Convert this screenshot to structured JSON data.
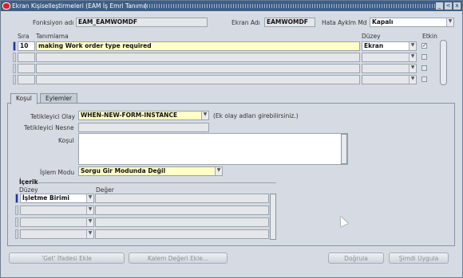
{
  "window": {
    "title": "Ekran Kişiselleştirmeleri (EAM İş Emri Tanımı)",
    "minimize_label": "_",
    "restore_label": "<",
    "close_label": "x"
  },
  "header": {
    "function_label": "Fonksiyon adı",
    "function_value": "EAM_EAMWOMDF",
    "screen_label": "Ekran Adı",
    "screen_value": "EAMWOMDF",
    "error_label": "Hata Ayklm Md",
    "error_value": "Kapalı"
  },
  "grid": {
    "columns": {
      "seq": "Sıra",
      "definition": "Tanımlama",
      "level": "Düzey",
      "active": "Etkin"
    },
    "rows": [
      {
        "seq": "10",
        "definition": "making Work order type required",
        "level": "Ekran",
        "active": "✓"
      },
      {
        "seq": "",
        "definition": "",
        "level": "",
        "active": ""
      },
      {
        "seq": "",
        "definition": "",
        "level": "",
        "active": ""
      },
      {
        "seq": "",
        "definition": "",
        "level": "",
        "active": ""
      }
    ]
  },
  "tabs": [
    {
      "label": "Koşul",
      "active": true
    },
    {
      "label": "Eylemler",
      "active": false
    }
  ],
  "condition": {
    "trigger_event_label": "Tetikleyici Olay",
    "trigger_event_value": "WHEN-NEW-FORM-INSTANCE",
    "trigger_hint": "(Ek olay adları girebilirsiniz.)",
    "trigger_object_label": "Tetikleyici Nesne",
    "trigger_object_value": "",
    "condition_label": "Koşul",
    "condition_value": "",
    "mode_label": "İşlem Modu",
    "mode_value": "Sorgu Gir  Modunda Değil"
  },
  "content": {
    "title": "İçerik",
    "level_header": "Düzey",
    "value_header": "Değer",
    "rows": [
      {
        "level": "İşletme Birimi",
        "value": ""
      },
      {
        "level": "",
        "value": ""
      },
      {
        "level": "",
        "value": ""
      },
      {
        "level": "",
        "value": ""
      }
    ]
  },
  "buttons": {
    "get_expression": "'Get' İfadesi Ekle",
    "item_value": "Kalem Değeri Ekle...",
    "validate": "Doğrula",
    "apply_now": "Şimdi Uygula"
  }
}
